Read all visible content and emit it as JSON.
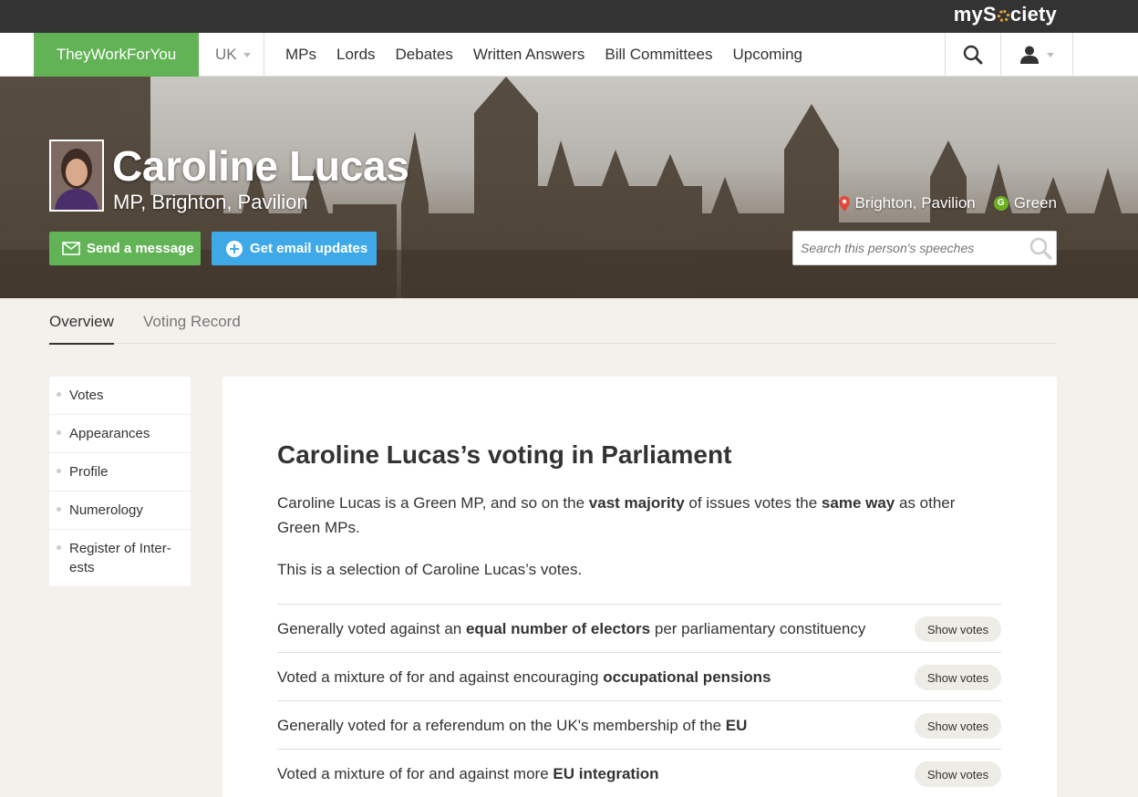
{
  "topbar": {
    "brand_pre": "myS",
    "brand_post": "ciety"
  },
  "nav": {
    "brand": "TheyWorkForYou",
    "country": "UK",
    "links": [
      "MPs",
      "Lords",
      "Debates",
      "Written Answers",
      "Bill Committees",
      "Upcoming"
    ]
  },
  "person": {
    "name": "Caroline Lucas",
    "role": "MP, Brighton, Pavilion",
    "constituency": "Brighton, Pavilion",
    "party": "Green",
    "party_badge": "G",
    "party_color": "#6ab023"
  },
  "actions": {
    "message": "Send a message",
    "alerts": "Get email updates"
  },
  "search": {
    "placeholder": "Search this person's speeches"
  },
  "tabs": {
    "overview": "Overview",
    "voting": "Voting Record"
  },
  "sidebar": {
    "items": [
      "Votes",
      "Appearances",
      "Profile",
      "Numerology",
      "Register of Inter-\nests"
    ]
  },
  "main": {
    "title": "Caroline Lucas’s voting in Parliament",
    "intro": {
      "part1": "Caroline Lucas is a Green MP, and so on the ",
      "bold1": "vast majority",
      "part2": " of issues votes the ",
      "bold2": "same way",
      "part3": " as other Green MPs."
    },
    "selection": "This is a selection of Caroline Lucas’s votes.",
    "show_votes_label": "Show votes",
    "votes": [
      {
        "pre": "Generally voted against an ",
        "bold": "equal number of electors",
        "post": " per parliamentary constituency"
      },
      {
        "pre": "Voted a mixture of for and against encouraging ",
        "bold": "occupational pensions",
        "post": ""
      },
      {
        "pre": "Generally voted for a referendum on the UK's membership of the ",
        "bold": "EU",
        "post": ""
      },
      {
        "pre": "Voted a mixture of for and against more ",
        "bold": "EU integration",
        "post": ""
      }
    ]
  },
  "colors": {
    "green": "#62b356",
    "blue": "#3fa9e8",
    "dark": "#333333",
    "background": "#f3f1eb"
  }
}
